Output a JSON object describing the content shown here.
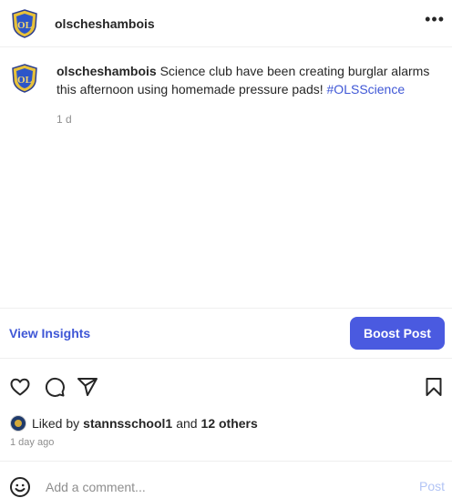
{
  "post": {
    "username": "olscheshambois",
    "caption": {
      "username": "olscheshambois",
      "text": "Science club have been creating burglar alarms this afternoon using homemade pressure pads!",
      "hashtag": "#OLSScience"
    },
    "caption_age": "1 d"
  },
  "actions": {
    "insights_label": "View Insights",
    "boost_label": "Boost Post"
  },
  "likes": {
    "prefix": "Liked by",
    "user": "stannsschool1",
    "middle": "and",
    "others": "12 others"
  },
  "timestamp": "1 day ago",
  "comment": {
    "placeholder": "Add a comment...",
    "post_label": "Post"
  },
  "icons": {
    "more": "more-options-icon",
    "like": "heart-icon",
    "comment": "comment-icon",
    "share": "share-icon",
    "save": "bookmark-icon",
    "emoji": "emoji-icon"
  },
  "colors": {
    "accent": "#4a5ae0",
    "link": "#3f57d6",
    "muted": "#8e8e8e",
    "post_disabled": "#b2c4f5"
  }
}
